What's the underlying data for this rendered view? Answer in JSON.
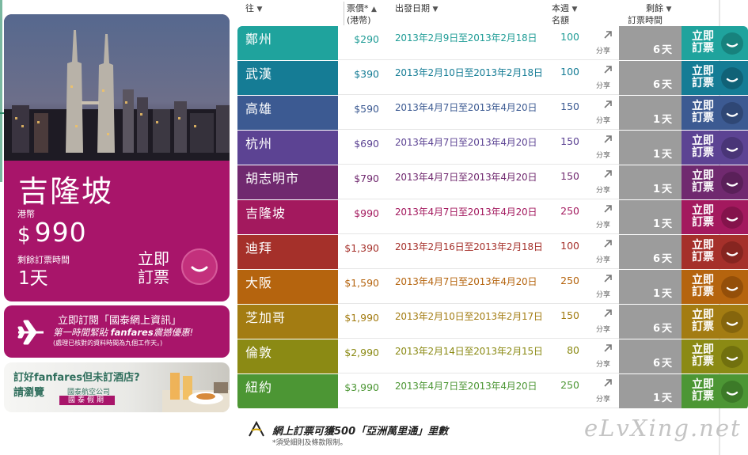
{
  "colors": {
    "magenta": "#a8156a",
    "days_bg": "#9c9c9c",
    "header_text": "#333333"
  },
  "feature": {
    "city": "吉隆坡",
    "currency": "港幣",
    "price_symbol": "$",
    "price": "990",
    "remaining_label": "剩餘訂票時間",
    "remaining_value": "1天",
    "book_label": "立即訂票"
  },
  "newsletter": {
    "title": "立即訂閱「國泰網上資訊」",
    "line2_prefix": "第一時間緊貼 ",
    "line2_brand": "fanfares",
    "line2_suffix": "震撼優惠!",
    "note": "(處理已核對的資料時間為九個工作天。)"
  },
  "hotel": {
    "line1": "訂好fanfares但未訂酒店?",
    "line2": "請瀏覽",
    "airline": "國泰航空公司",
    "badge": "國泰假期"
  },
  "headers": {
    "dest": "往",
    "price": "票價*",
    "price_unit": "(港幣)",
    "date": "出發日期",
    "quota_1": "本週",
    "quota_2": "名額",
    "remain_1": "剩餘",
    "remain_2": "訂票時間"
  },
  "row_labels": {
    "share": "分享",
    "book": "立即訂票"
  },
  "rows": [
    {
      "dest": "鄭州",
      "price": "$290",
      "date": "2013年2月9日至2013年2月18日",
      "quota": "100",
      "days": "6天",
      "color": "#1fa39d",
      "price_color": "#1f9c96",
      "circle": "#17827d"
    },
    {
      "dest": "武漢",
      "price": "$390",
      "date": "2013年2月10日至2013年2月18日",
      "quota": "100",
      "days": "6天",
      "color": "#157c95",
      "price_color": "#157c95",
      "circle": "#106277"
    },
    {
      "dest": "高雄",
      "price": "$590",
      "date": "2013年4月7日至2013年4月20日",
      "quota": "150",
      "days": "1天",
      "color": "#3c5a92",
      "price_color": "#3c5a92",
      "circle": "#2f4775"
    },
    {
      "dest": "杭州",
      "price": "$690",
      "date": "2013年4月7日至2013年4月20日",
      "quota": "150",
      "days": "1天",
      "color": "#5c4393",
      "price_color": "#5c4393",
      "circle": "#493577"
    },
    {
      "dest": "胡志明市",
      "price": "$790",
      "date": "2013年4月7日至2013年4月20日",
      "quota": "150",
      "days": "1天",
      "color": "#70296f",
      "price_color": "#70296f",
      "circle": "#5a2059"
    },
    {
      "dest": "吉隆坡",
      "price": "$990",
      "date": "2013年4月7日至2013年4月20日",
      "quota": "250",
      "days": "1天",
      "color": "#a3195e",
      "price_color": "#a3195e",
      "circle": "#84134b"
    },
    {
      "dest": "迪拜",
      "price": "$1,390",
      "date": "2013年2月16日至2013年2月18日",
      "quota": "100",
      "days": "6天",
      "color": "#a5302a",
      "price_color": "#a5302a",
      "circle": "#862520"
    },
    {
      "dest": "大阪",
      "price": "$1,590",
      "date": "2013年4月7日至2013年4月20日",
      "quota": "250",
      "days": "1天",
      "color": "#b5640e",
      "price_color": "#b5640e",
      "circle": "#944f09"
    },
    {
      "dest": "芝加哥",
      "price": "$1,990",
      "date": "2013年2月10日至2013年2月17日",
      "quota": "150",
      "days": "6天",
      "color": "#a37c12",
      "price_color": "#a37c12",
      "circle": "#85650d"
    },
    {
      "dest": "倫敦",
      "price": "$2,990",
      "date": "2013年2月14日至2013年2月15日",
      "quota": "80",
      "days": "6天",
      "color": "#8b8a14",
      "price_color": "#8b8a14",
      "circle": "#71700e"
    },
    {
      "dest": "紐約",
      "price": "$3,990",
      "date": "2013年4月7日至2013年4月20日",
      "quota": "250",
      "days": "1天",
      "color": "#4c9634",
      "price_color": "#4c9634",
      "circle": "#3c7a28"
    }
  ],
  "footer": {
    "main": "網上訂票可獲500「亞洲萬里通」里數",
    "note": "*須受細則及條款限制。"
  },
  "watermark": "eLvXing.net"
}
